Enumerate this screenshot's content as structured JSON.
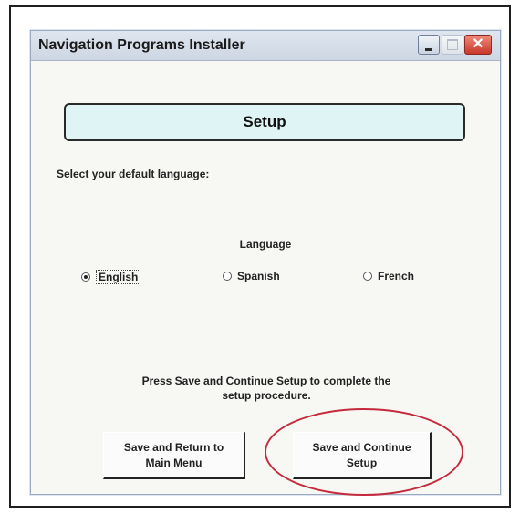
{
  "window": {
    "title": "Navigation Programs Installer",
    "controls": {
      "minimize_icon": "minimize-icon",
      "maximize_icon": "maximize-icon",
      "close_icon": "close-icon",
      "close_glyph": "✕"
    }
  },
  "header": {
    "title": "Setup"
  },
  "prompt": "Select your default language:",
  "language": {
    "label": "Language",
    "options": [
      {
        "label": "English",
        "selected": true
      },
      {
        "label": "Spanish",
        "selected": false
      },
      {
        "label": "French",
        "selected": false
      }
    ]
  },
  "instructions": {
    "line1": "Press Save and Continue Setup to complete the",
    "line2": "setup procedure."
  },
  "buttons": {
    "return_line1": "Save and Return to",
    "return_line2": "Main Menu",
    "continue_line1": "Save and Continue",
    "continue_line2": "Setup"
  },
  "colors": {
    "header_bg": "#def4f5",
    "highlight": "#c42a3c",
    "close_button": "#c8382a"
  }
}
